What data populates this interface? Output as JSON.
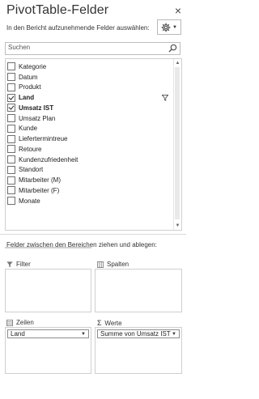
{
  "pane": {
    "title": "PivotTable-Felder",
    "close": "×",
    "subtitle": "In den Bericht aufzunehmende Felder auswählen:"
  },
  "search": {
    "placeholder": "Suchen"
  },
  "fields": [
    {
      "label": "Kategorie",
      "checked": false,
      "bold": false
    },
    {
      "label": "Datum",
      "checked": false,
      "bold": false
    },
    {
      "label": "Produkt",
      "checked": false,
      "bold": false
    },
    {
      "label": "Land",
      "checked": true,
      "bold": true,
      "filtered": true
    },
    {
      "label": "Umsatz IST",
      "checked": true,
      "bold": true
    },
    {
      "label": "Umsatz Plan",
      "checked": false,
      "bold": false
    },
    {
      "label": "Kunde",
      "checked": false,
      "bold": false
    },
    {
      "label": "Liefertermintreue",
      "checked": false,
      "bold": false
    },
    {
      "label": "Retoure",
      "checked": false,
      "bold": false
    },
    {
      "label": "Kundenzufriedenheit",
      "checked": false,
      "bold": false
    },
    {
      "label": "Standort",
      "checked": false,
      "bold": false
    },
    {
      "label": "Mitarbeiter (M)",
      "checked": false,
      "bold": false
    },
    {
      "label": "Mitarbeiter (F)",
      "checked": false,
      "bold": false
    },
    {
      "label": "Monate",
      "checked": false,
      "bold": false
    }
  ],
  "areas": {
    "hint": "Felder zwischen den Bereichen ziehen und ablegen:",
    "filter": {
      "label": "Filter"
    },
    "columns": {
      "label": "Spalten"
    },
    "rows": {
      "label": "Zeilen",
      "items": [
        "Land"
      ]
    },
    "values": {
      "label": "Werte",
      "items": [
        "Summe von Umsatz IST"
      ]
    }
  }
}
